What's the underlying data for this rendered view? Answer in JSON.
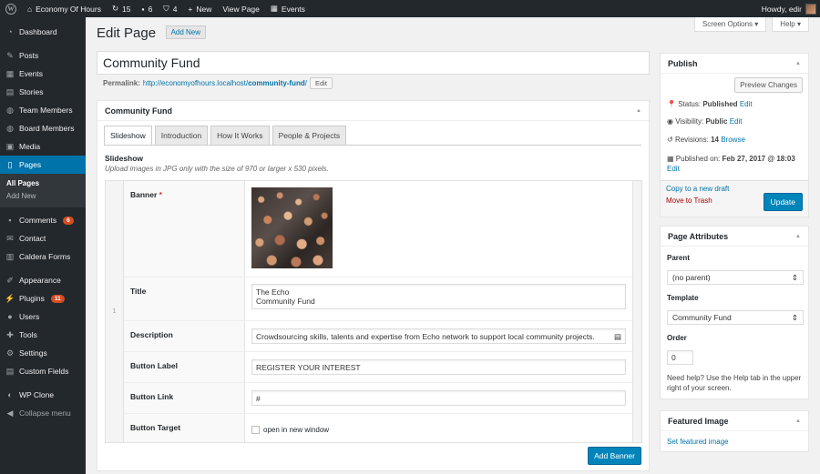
{
  "adminbar": {
    "site_name": "Economy Of Hours",
    "updates": "15",
    "comments": "6",
    "wpforms": "4",
    "new_label": "New",
    "view_page": "View Page",
    "events": "Events",
    "howdy": "Howdy, edir"
  },
  "sidebar": {
    "items": [
      {
        "label": "Dashboard",
        "icon": "dashboard-icon"
      },
      {
        "label": "Posts",
        "icon": "pin-icon"
      },
      {
        "label": "Events",
        "icon": "calendar-icon"
      },
      {
        "label": "Stories",
        "icon": "stories-icon"
      },
      {
        "label": "Team Members",
        "icon": "group-icon"
      },
      {
        "label": "Board Members",
        "icon": "group-icon"
      },
      {
        "label": "Media",
        "icon": "media-icon"
      },
      {
        "label": "Pages",
        "icon": "pages-icon"
      },
      {
        "label": "Comments",
        "icon": "comment-icon",
        "badge": "6"
      },
      {
        "label": "Contact",
        "icon": "mail-icon"
      },
      {
        "label": "Caldera Forms",
        "icon": "forms-icon"
      },
      {
        "label": "Appearance",
        "icon": "brush-icon"
      },
      {
        "label": "Plugins",
        "icon": "plugin-icon",
        "badge": "11"
      },
      {
        "label": "Users",
        "icon": "user-icon"
      },
      {
        "label": "Tools",
        "icon": "wrench-icon"
      },
      {
        "label": "Settings",
        "icon": "settings-icon"
      },
      {
        "label": "Custom Fields",
        "icon": "fields-icon"
      },
      {
        "label": "WP Clone",
        "icon": "clone-icon"
      },
      {
        "label": "Collapse menu",
        "icon": "collapse-icon"
      }
    ],
    "submenu": {
      "all_pages": "All Pages",
      "add_new": "Add New"
    }
  },
  "screen_options": "Screen Options ▾",
  "help": "Help ▾",
  "header": {
    "title": "Edit Page",
    "add_new": "Add New"
  },
  "post_title": "Community Fund",
  "permalink": {
    "label": "Permalink:",
    "url_base": "http://economyofhours.localhost/",
    "slug": "community-fund",
    "url_end": "/",
    "edit": "Edit"
  },
  "metabox": {
    "title": "Community Fund",
    "tabs": [
      "Slideshow",
      "Introduction",
      "How It Works",
      "People & Projects"
    ],
    "field_label": "Slideshow",
    "field_desc": "Upload images in JPG only with the size of 970 or larger x 530 pixels.",
    "row_number": "1",
    "fields": {
      "banner": "Banner",
      "required_mark": "*",
      "title_label": "Title",
      "title_line1": "The Echo",
      "title_line2": "Community Fund",
      "description_label": "Description",
      "description_value": "Crowdsourcing skills, talents and expertise from Echo network to support local community projects.",
      "button_label_label": "Button Label",
      "button_label_value": "REGISTER YOUR INTEREST",
      "button_link_label": "Button Link",
      "button_link_value": "#",
      "button_target_label": "Button Target",
      "button_target_option": "open in new window"
    },
    "add_banner": "Add Banner"
  },
  "publish": {
    "title": "Publish",
    "preview": "Preview Changes",
    "status_label": "Status:",
    "status_value": "Published",
    "visibility_label": "Visibility:",
    "visibility_value": "Public",
    "revisions_label": "Revisions:",
    "revisions_value": "14",
    "browse": "Browse",
    "published_label": "Published on:",
    "published_value": "Feb 27, 2017 @ 18:03",
    "edit": "Edit",
    "copy_draft": "Copy to a new draft",
    "trash": "Move to Trash",
    "update": "Update"
  },
  "page_attributes": {
    "title": "Page Attributes",
    "parent_label": "Parent",
    "parent_value": "(no parent)",
    "template_label": "Template",
    "template_value": "Community Fund",
    "order_label": "Order",
    "order_value": "0",
    "help_text": "Need help? Use the Help tab in the upper right of your screen."
  },
  "featured_image": {
    "title": "Featured Image",
    "link": "Set featured image"
  },
  "colors": {
    "accent": "#0073aa",
    "sidebar": "#23282d",
    "button": "#0085ba",
    "trash": "#a00"
  }
}
